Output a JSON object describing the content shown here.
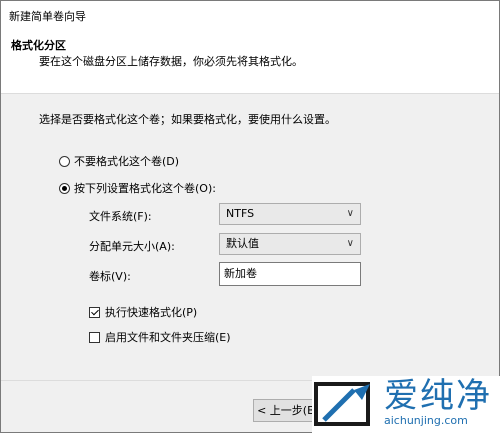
{
  "window": {
    "title": "新建简单卷向导"
  },
  "header": {
    "title": "格式化分区",
    "subtitle": "要在这个磁盘分区上储存数据，你必须先将其格式化。"
  },
  "content": {
    "intro": "选择是否要格式化这个卷；如果要格式化，要使用什么设置。",
    "radio_no_format": "不要格式化这个卷(D)",
    "radio_format": "按下列设置格式化这个卷(O):",
    "selected_option": "format",
    "filesystem": {
      "label": "文件系统(F):",
      "value": "NTFS"
    },
    "allocation": {
      "label": "分配单元大小(A):",
      "value": "默认值"
    },
    "volume_label": {
      "label": "卷标(V):",
      "value": "新加卷"
    },
    "quick_format": {
      "label": "执行快速格式化(P)",
      "checked": true
    },
    "compression": {
      "label": "启用文件和文件夹压缩(E)",
      "checked": false
    }
  },
  "buttons": {
    "back": "< 上一步(B)"
  },
  "watermark": {
    "brand": "爱纯净",
    "url": "aichunjing.com"
  }
}
